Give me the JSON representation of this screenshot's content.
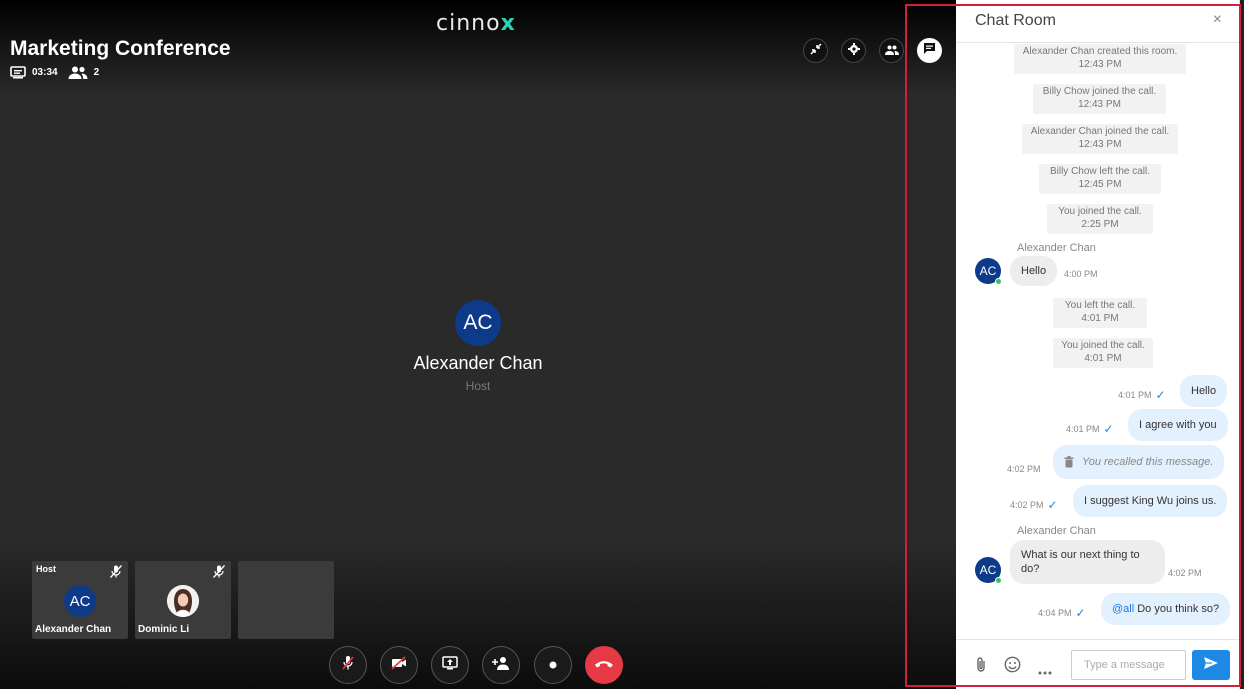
{
  "app": {
    "logo_main": "cinno",
    "logo_accent": "x"
  },
  "conference": {
    "title": "Marketing Conference",
    "duration": "03:34",
    "participants": "2"
  },
  "speaker": {
    "initials": "AC",
    "name": "Alexander Chan",
    "role": "Host"
  },
  "tiles": [
    {
      "badge": "Host",
      "initials": "AC",
      "name": "Alexander Chan"
    },
    {
      "name": "Dominic Li"
    }
  ],
  "icons": {
    "minimize": "minimize-icon",
    "settings": "gear-icon",
    "participants": "people-icon",
    "chat": "chat-icon",
    "mute_mic": "mic-off-icon",
    "camera_off": "camera-off-icon",
    "share_screen": "screen-share-icon",
    "add_person": "add-person-icon",
    "record": "record-icon",
    "end_call": "phone-hangup-icon",
    "attach": "paperclip-icon",
    "emoji": "emoji-icon",
    "more": "more-horizontal-icon",
    "send": "send-icon"
  },
  "colors": {
    "accent": "#1e88e5",
    "end_call": "#e53945",
    "avatar": "#0e3a8a",
    "online": "#36c25a",
    "logo_accent": "#2bd3b4",
    "highlight": "#d0203c"
  },
  "chat": {
    "title": "Chat Room",
    "close": "×",
    "events": [
      {
        "text": "Alexander Chan created this room.",
        "time": "12:43 PM"
      },
      {
        "text": "Billy Chow joined the call.",
        "time": "12:43 PM"
      },
      {
        "text": "Alexander Chan joined the call.",
        "time": "12:43 PM"
      },
      {
        "text": "Billy Chow left the call.",
        "time": "12:45 PM"
      },
      {
        "text": "You joined the call.",
        "time": "2:25 PM"
      },
      {
        "text": "You left the call.",
        "time": "4:01 PM"
      },
      {
        "text": "You joined the call.",
        "time": "4:01 PM"
      }
    ],
    "incoming": [
      {
        "sender": "Alexander Chan",
        "initials": "AC",
        "text": "Hello",
        "time": "4:00 PM"
      },
      {
        "sender": "Alexander Chan",
        "initials": "AC",
        "text": "What is our next thing to do?",
        "time": "4:02 PM"
      }
    ],
    "outgoing": [
      {
        "text": "Hello",
        "time": "4:01 PM"
      },
      {
        "text": "I agree with you",
        "time": "4:01 PM"
      },
      {
        "text": "You recalled this message.",
        "time": "4:02 PM"
      },
      {
        "text": "I suggest King Wu joins us.",
        "time": "4:02 PM"
      },
      {
        "mention": "@all",
        "text": " Do you think so?",
        "time": "4:04 PM"
      }
    ],
    "input_placeholder": "Type a message"
  }
}
